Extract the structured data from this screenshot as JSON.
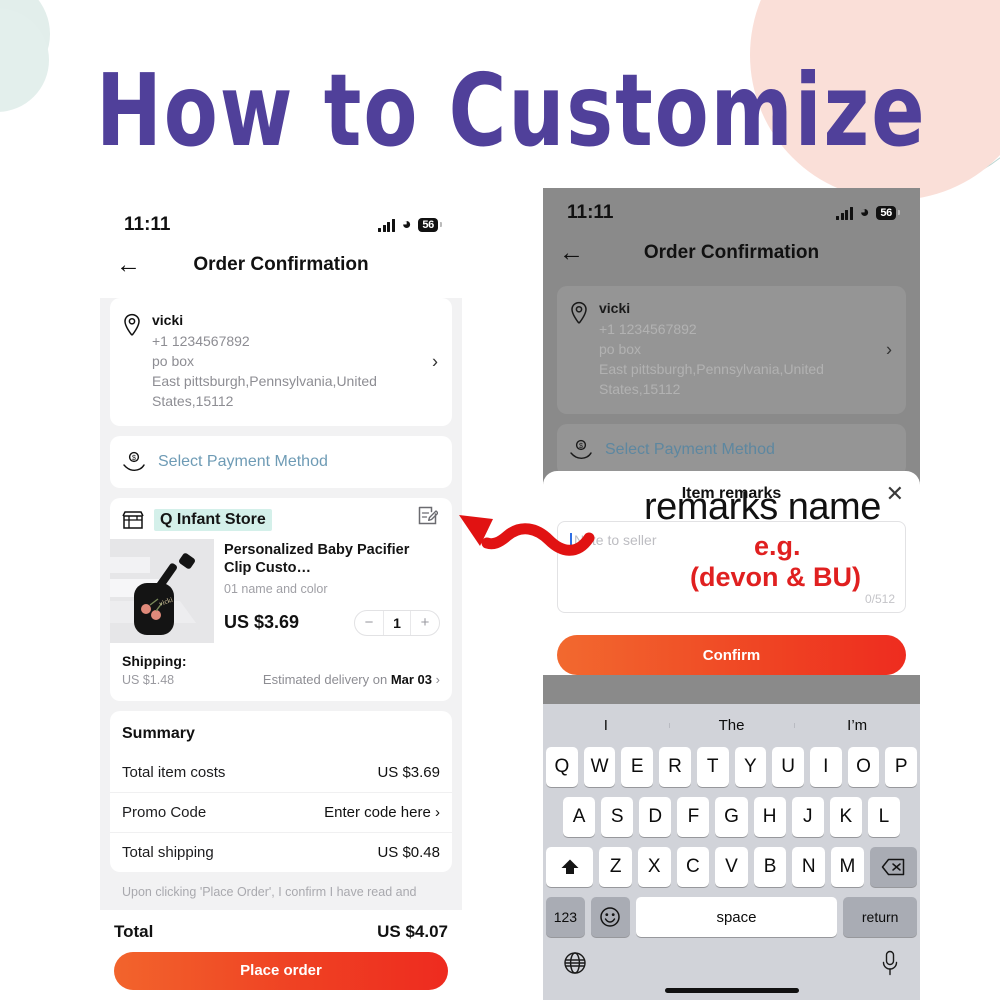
{
  "banner": {
    "heading": "How to Customize"
  },
  "colors": {
    "heading_purple": "#50409a",
    "cta_orange": "#ef4423",
    "mint_highlight": "#d4f0ea",
    "annotation_red": "#e02020",
    "link_blue": "#6e9bb5"
  },
  "left_phone": {
    "status_bar": {
      "time": "11:11",
      "battery": "56",
      "signal_icon": "cellular-bars-icon",
      "wifi_icon": "wifi-icon"
    },
    "nav": {
      "back_icon": "back-arrow-icon",
      "title": "Order Confirmation"
    },
    "address": {
      "pin_icon": "location-pin-icon",
      "name": "vicki",
      "phone": "+1 1234567892",
      "line1": "po box",
      "line2": "East pittsburgh,Pennsylvania,United",
      "line3": "States,15112",
      "chevron": "›"
    },
    "payment": {
      "icon": "payment-hand-icon",
      "label": "Select Payment Method"
    },
    "store": {
      "icon": "storefront-icon",
      "name": "Q Infant Store",
      "edit_icon": "edit-note-icon"
    },
    "product": {
      "title": "Personalized Baby Pacifier Clip Custo…",
      "variant": "01 name and color",
      "price": "US $3.69",
      "qty": "1",
      "minus": "−",
      "plus": "+"
    },
    "shipping": {
      "label": "Shipping:",
      "cost": "US $1.48",
      "eta_prefix": "Estimated delivery on",
      "eta_date": "Mar 03",
      "chevron": "›"
    },
    "summary": {
      "title": "Summary",
      "rows": [
        {
          "label": "Total item costs",
          "value": "US $3.69"
        },
        {
          "label": "Promo Code",
          "value": "Enter code here ›"
        },
        {
          "label": "Total shipping",
          "value": "US $0.48"
        }
      ]
    },
    "consent": "Upon clicking 'Place Order', I confirm I have read and",
    "footer": {
      "total_label": "Total",
      "total_value": "US $4.07",
      "cta_label": "Place order"
    }
  },
  "right_phone": {
    "status_bar": {
      "time": "11:11",
      "battery": "56"
    },
    "nav": {
      "title": "Order Confirmation"
    },
    "address": {
      "name": "vicki",
      "phone": "+1 1234567892",
      "line1": "po box",
      "line2": "East pittsburgh,Pennsylvania,United",
      "line3": "States,15112"
    },
    "payment": {
      "label": "Select Payment Method"
    },
    "sheet": {
      "title": "Item remarks",
      "close_icon": "close-x-icon",
      "note_placeholder": "Note to seller",
      "counter": "0/512",
      "confirm_label": "Confirm"
    },
    "keyboard": {
      "predictions": [
        "I",
        "The",
        "I’m"
      ],
      "row1": [
        "Q",
        "W",
        "E",
        "R",
        "T",
        "Y",
        "U",
        "I",
        "O",
        "P"
      ],
      "row2": [
        "A",
        "S",
        "D",
        "F",
        "G",
        "H",
        "J",
        "K",
        "L"
      ],
      "row3": [
        "Z",
        "X",
        "C",
        "V",
        "B",
        "N",
        "M"
      ],
      "shift_icon": "shift-arrow-icon",
      "backspace_icon": "backspace-icon",
      "numbers_key": "123",
      "emoji_icon": "emoji-smiley-icon",
      "space_key": "space",
      "return_key": "return",
      "globe_icon": "globe-icon",
      "mic_icon": "microphone-icon"
    }
  },
  "annotations": {
    "remarks_name": "remarks name",
    "eg": "e.g.",
    "example": "(devon & BU)",
    "arrow_icon": "red-wavy-arrow-icon"
  }
}
